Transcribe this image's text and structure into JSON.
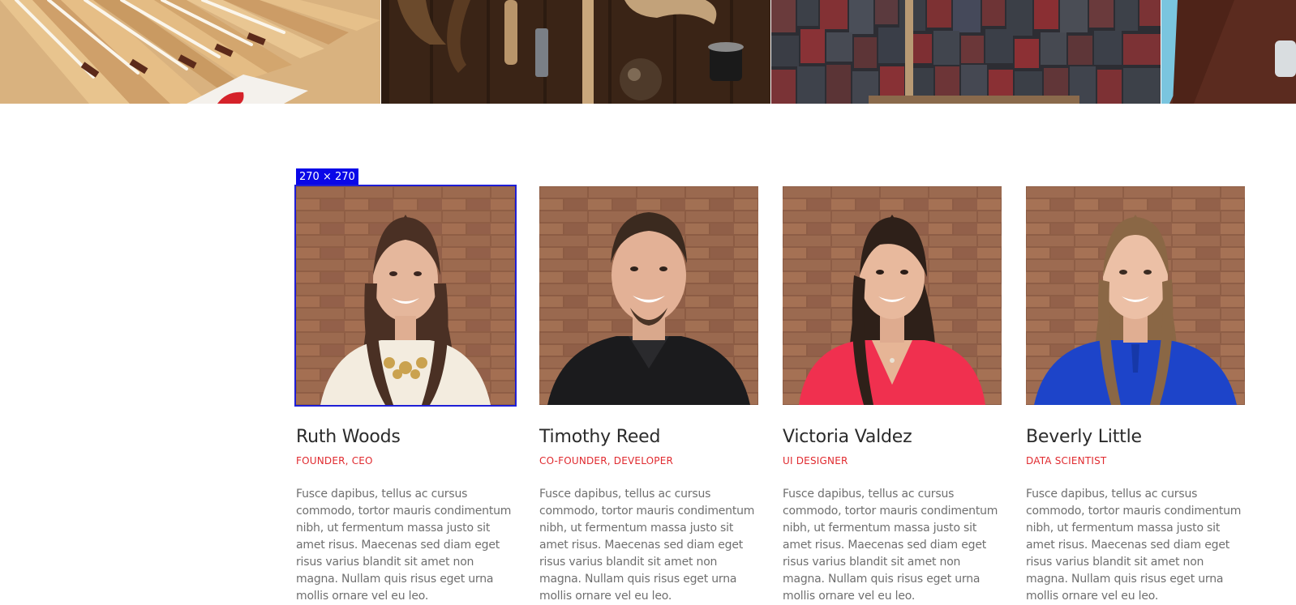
{
  "strip": {
    "tiles": [
      {
        "icon": "rulers-photo"
      },
      {
        "icon": "tools-photo"
      },
      {
        "icon": "letterpress-type-photo"
      },
      {
        "icon": "workspace-photo"
      }
    ]
  },
  "selection_badge": "270 × 270",
  "team": {
    "members": [
      {
        "name": "Ruth Woods",
        "role": "FOUNDER, CEO",
        "bio": "Fusce dapibus, tellus ac cursus commodo, tortor mauris condimentum nibh, ut fermentum massa justo sit amet risus. Maecenas sed diam eget risus varius blandit sit amet non magna. Nullam quis risus eget urna mollis ornare vel eu leo.",
        "shirt_color": "#f3ecdf",
        "hair_color": "#4a3024"
      },
      {
        "name": "Timothy Reed",
        "role": "CO-FOUNDER, DEVELOPER",
        "bio": "Fusce dapibus, tellus ac cursus commodo, tortor mauris condimentum nibh, ut fermentum massa justo sit amet risus. Maecenas sed diam eget risus varius blandit sit amet non magna. Nullam quis risus eget urna mollis ornare vel eu leo.",
        "shirt_color": "#1b1b1d",
        "hair_color": "#3b2a1f"
      },
      {
        "name": "Victoria Valdez",
        "role": "UI DESIGNER",
        "bio": "Fusce dapibus, tellus ac cursus commodo, tortor mauris condimentum nibh, ut fermentum massa justo sit amet risus. Maecenas sed diam eget risus varius blandit sit amet non magna. Nullam quis risus eget urna mollis ornare vel eu leo.",
        "shirt_color": "#f0304f",
        "hair_color": "#2e2019"
      },
      {
        "name": "Beverly Little",
        "role": "DATA SCIENTIST",
        "bio": "Fusce dapibus, tellus ac cursus commodo, tortor mauris condimentum nibh, ut fermentum massa justo sit amet risus. Maecenas sed diam eget risus varius blandit sit amet non magna. Nullam quis risus eget urna mollis ornare vel eu leo.",
        "shirt_color": "#1d44c9",
        "hair_color": "#8a6745"
      }
    ]
  },
  "colors": {
    "accent": "#e02a2f",
    "selection": "#1f1fd6",
    "badge": "#0a07e8",
    "brick": "#8f5e45"
  }
}
